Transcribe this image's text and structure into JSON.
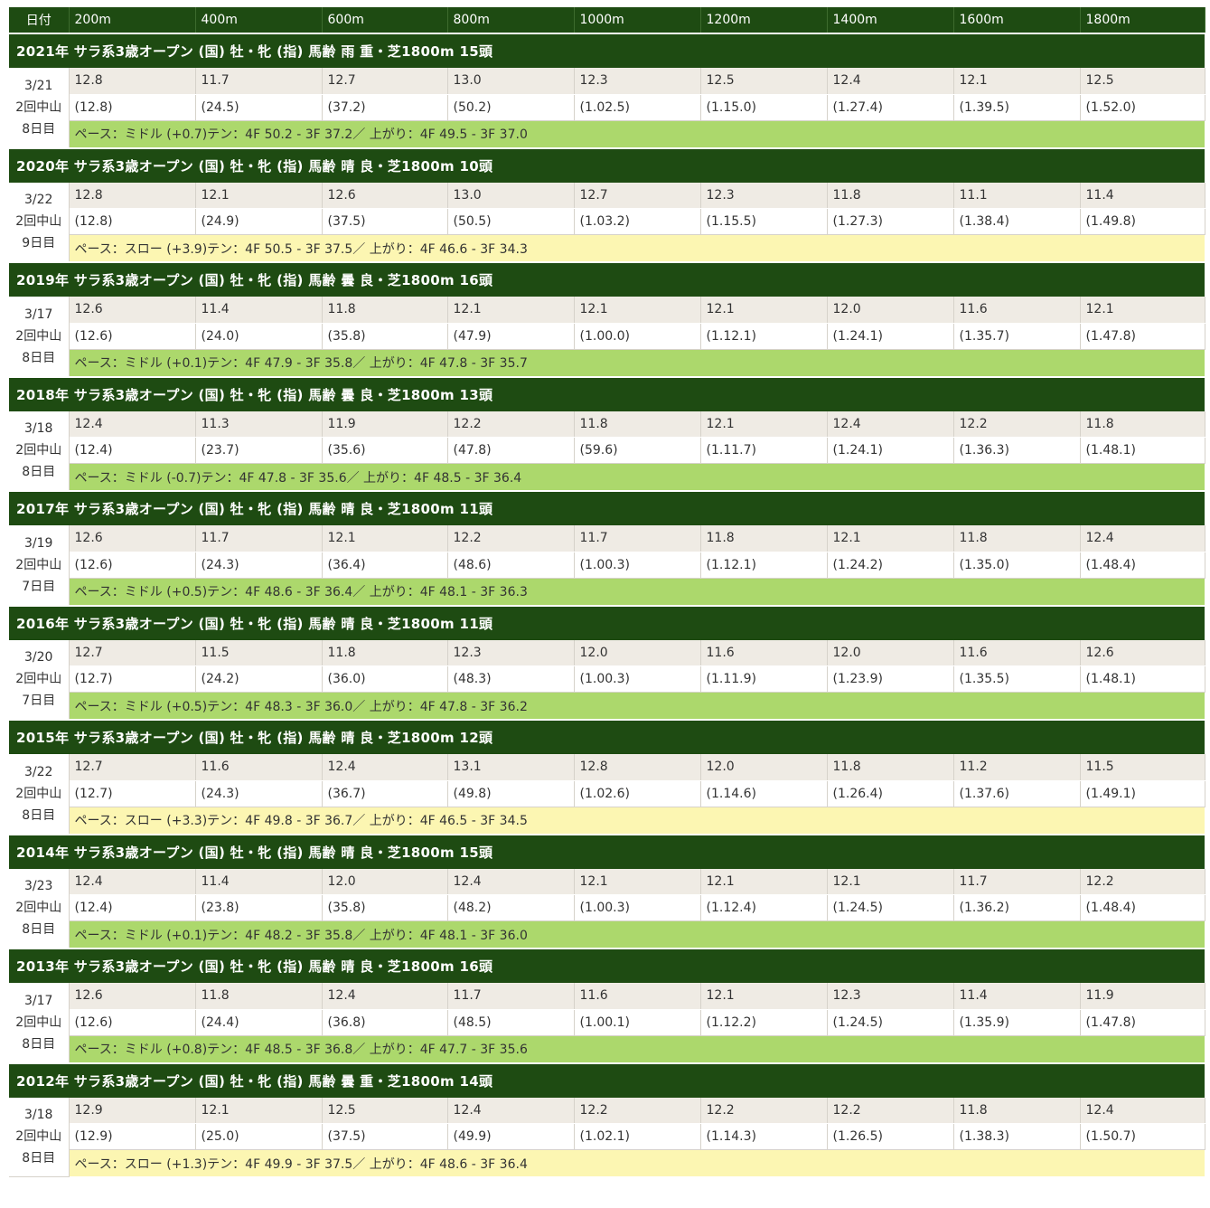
{
  "header": {
    "date_label": "日付",
    "distances": [
      "200m",
      "400m",
      "600m",
      "800m",
      "1000m",
      "1200m",
      "1400m",
      "1600m",
      "1800m"
    ]
  },
  "races": [
    {
      "title": "2021年 サラ系3歳オープン (国) 牡・牝 (指) 馬齢 雨 重・芝1800m 15頭",
      "date": "3/21",
      "meet": "2回中山",
      "day": "8日目",
      "laps": [
        "12.8",
        "11.7",
        "12.7",
        "13.0",
        "12.3",
        "12.5",
        "12.4",
        "12.1",
        "12.5"
      ],
      "fast": [
        false,
        true,
        false,
        false,
        false,
        false,
        false,
        false,
        false
      ],
      "cumulative": [
        "(12.8)",
        "(24.5)",
        "(37.2)",
        "(50.2)",
        "(1.02.5)",
        "(1.15.0)",
        "(1.27.4)",
        "(1.39.5)",
        "(1.52.0)"
      ],
      "pace": "ペース：ミドル (+0.7)テン：4F 50.2 - 3F 37.2／ 上がり：4F 49.5 - 3F 37.0",
      "pace_type": "middle"
    },
    {
      "title": "2020年 サラ系3歳オープン (国) 牡・牝 (指) 馬齢 晴 良・芝1800m 10頭",
      "date": "3/22",
      "meet": "2回中山",
      "day": "9日目",
      "laps": [
        "12.8",
        "12.1",
        "12.6",
        "13.0",
        "12.7",
        "12.3",
        "11.8",
        "11.1",
        "11.4"
      ],
      "fast": [
        false,
        false,
        false,
        false,
        false,
        false,
        true,
        true,
        true
      ],
      "cumulative": [
        "(12.8)",
        "(24.9)",
        "(37.5)",
        "(50.5)",
        "(1.03.2)",
        "(1.15.5)",
        "(1.27.3)",
        "(1.38.4)",
        "(1.49.8)"
      ],
      "pace": "ペース：スロー (+3.9)テン：4F 50.5 - 3F 37.5／ 上がり：4F 46.6 - 3F 34.3",
      "pace_type": "slow"
    },
    {
      "title": "2019年 サラ系3歳オープン (国) 牡・牝 (指) 馬齢 曇 良・芝1800m 16頭",
      "date": "3/17",
      "meet": "2回中山",
      "day": "8日目",
      "laps": [
        "12.6",
        "11.4",
        "11.8",
        "12.1",
        "12.1",
        "12.1",
        "12.0",
        "11.6",
        "12.1"
      ],
      "fast": [
        false,
        true,
        true,
        false,
        false,
        false,
        false,
        true,
        false
      ],
      "cumulative": [
        "(12.6)",
        "(24.0)",
        "(35.8)",
        "(47.9)",
        "(1.00.0)",
        "(1.12.1)",
        "(1.24.1)",
        "(1.35.7)",
        "(1.47.8)"
      ],
      "pace": "ペース：ミドル (+0.1)テン：4F 47.9 - 3F 35.8／ 上がり：4F 47.8 - 3F 35.7",
      "pace_type": "middle"
    },
    {
      "title": "2018年 サラ系3歳オープン (国) 牡・牝 (指) 馬齢 曇 良・芝1800m 13頭",
      "date": "3/18",
      "meet": "2回中山",
      "day": "8日目",
      "laps": [
        "12.4",
        "11.3",
        "11.9",
        "12.2",
        "11.8",
        "12.1",
        "12.4",
        "12.2",
        "11.8"
      ],
      "fast": [
        false,
        true,
        true,
        false,
        true,
        false,
        false,
        false,
        true
      ],
      "cumulative": [
        "(12.4)",
        "(23.7)",
        "(35.6)",
        "(47.8)",
        "(59.6)",
        "(1.11.7)",
        "(1.24.1)",
        "(1.36.3)",
        "(1.48.1)"
      ],
      "pace": "ペース：ミドル (-0.7)テン：4F 47.8 - 3F 35.6／ 上がり：4F 48.5 - 3F 36.4",
      "pace_type": "middle"
    },
    {
      "title": "2017年 サラ系3歳オープン (国) 牡・牝 (指) 馬齢 晴 良・芝1800m 11頭",
      "date": "3/19",
      "meet": "2回中山",
      "day": "7日目",
      "laps": [
        "12.6",
        "11.7",
        "12.1",
        "12.2",
        "11.7",
        "11.8",
        "12.1",
        "11.8",
        "12.4"
      ],
      "fast": [
        false,
        true,
        false,
        false,
        true,
        true,
        false,
        true,
        false
      ],
      "cumulative": [
        "(12.6)",
        "(24.3)",
        "(36.4)",
        "(48.6)",
        "(1.00.3)",
        "(1.12.1)",
        "(1.24.2)",
        "(1.35.0)",
        "(1.48.4)"
      ],
      "pace": "ペース：ミドル (+0.5)テン：4F 48.6 - 3F 36.4／ 上がり：4F 48.1 - 3F 36.3",
      "pace_type": "middle"
    },
    {
      "title": "2016年 サラ系3歳オープン (国) 牡・牝 (指) 馬齢 晴 良・芝1800m 11頭",
      "date": "3/20",
      "meet": "2回中山",
      "day": "7日目",
      "laps": [
        "12.7",
        "11.5",
        "11.8",
        "12.3",
        "12.0",
        "11.6",
        "12.0",
        "11.6",
        "12.6"
      ],
      "fast": [
        false,
        true,
        true,
        false,
        false,
        true,
        false,
        true,
        false
      ],
      "cumulative": [
        "(12.7)",
        "(24.2)",
        "(36.0)",
        "(48.3)",
        "(1.00.3)",
        "(1.11.9)",
        "(1.23.9)",
        "(1.35.5)",
        "(1.48.1)"
      ],
      "pace": "ペース：ミドル (+0.5)テン：4F 48.3 - 3F 36.0／ 上がり：4F 47.8 - 3F 36.2",
      "pace_type": "middle"
    },
    {
      "title": "2015年 サラ系3歳オープン (国) 牡・牝 (指) 馬齢 晴 良・芝1800m 12頭",
      "date": "3/22",
      "meet": "2回中山",
      "day": "8日目",
      "laps": [
        "12.7",
        "11.6",
        "12.4",
        "13.1",
        "12.8",
        "12.0",
        "11.8",
        "11.2",
        "11.5"
      ],
      "fast": [
        false,
        true,
        false,
        false,
        false,
        false,
        true,
        true,
        true
      ],
      "cumulative": [
        "(12.7)",
        "(24.3)",
        "(36.7)",
        "(49.8)",
        "(1.02.6)",
        "(1.14.6)",
        "(1.26.4)",
        "(1.37.6)",
        "(1.49.1)"
      ],
      "pace": "ペース：スロー (+3.3)テン：4F 49.8 - 3F 36.7／ 上がり：4F 46.5 - 3F 34.5",
      "pace_type": "slow"
    },
    {
      "title": "2014年 サラ系3歳オープン (国) 牡・牝 (指) 馬齢 晴 良・芝1800m 15頭",
      "date": "3/23",
      "meet": "2回中山",
      "day": "8日目",
      "laps": [
        "12.4",
        "11.4",
        "12.0",
        "12.4",
        "12.1",
        "12.1",
        "12.1",
        "11.7",
        "12.2"
      ],
      "fast": [
        false,
        true,
        false,
        false,
        false,
        false,
        false,
        true,
        false
      ],
      "cumulative": [
        "(12.4)",
        "(23.8)",
        "(35.8)",
        "(48.2)",
        "(1.00.3)",
        "(1.12.4)",
        "(1.24.5)",
        "(1.36.2)",
        "(1.48.4)"
      ],
      "pace": "ペース：ミドル (+0.1)テン：4F 48.2 - 3F 35.8／ 上がり：4F 48.1 - 3F 36.0",
      "pace_type": "middle"
    },
    {
      "title": "2013年 サラ系3歳オープン (国) 牡・牝 (指) 馬齢 晴 良・芝1800m 16頭",
      "date": "3/17",
      "meet": "2回中山",
      "day": "8日目",
      "laps": [
        "12.6",
        "11.8",
        "12.4",
        "11.7",
        "11.6",
        "12.1",
        "12.3",
        "11.4",
        "11.9"
      ],
      "fast": [
        false,
        true,
        false,
        true,
        true,
        false,
        false,
        true,
        true
      ],
      "cumulative": [
        "(12.6)",
        "(24.4)",
        "(36.8)",
        "(48.5)",
        "(1.00.1)",
        "(1.12.2)",
        "(1.24.5)",
        "(1.35.9)",
        "(1.47.8)"
      ],
      "pace": "ペース：ミドル (+0.8)テン：4F 48.5 - 3F 36.8／ 上がり：4F 47.7 - 3F 35.6",
      "pace_type": "middle"
    },
    {
      "title": "2012年 サラ系3歳オープン (国) 牡・牝 (指) 馬齢 曇 重・芝1800m 14頭",
      "date": "3/18",
      "meet": "2回中山",
      "day": "8日目",
      "laps": [
        "12.9",
        "12.1",
        "12.5",
        "12.4",
        "12.2",
        "12.2",
        "12.2",
        "11.8",
        "12.4"
      ],
      "fast": [
        false,
        false,
        false,
        false,
        false,
        false,
        false,
        true,
        false
      ],
      "cumulative": [
        "(12.9)",
        "(25.0)",
        "(37.5)",
        "(49.9)",
        "(1.02.1)",
        "(1.14.3)",
        "(1.26.5)",
        "(1.38.3)",
        "(1.50.7)"
      ],
      "pace": "ペース：スロー (+1.3)テン：4F 49.9 - 3F 37.5／ 上がり：4F 48.6 - 3F 36.4",
      "pace_type": "slow"
    }
  ],
  "colors": {
    "header_bg": "#1e4b12",
    "fast_lap": "#e37a24",
    "pace_middle": "#acd86c",
    "pace_slow": "#fcf6b2"
  }
}
